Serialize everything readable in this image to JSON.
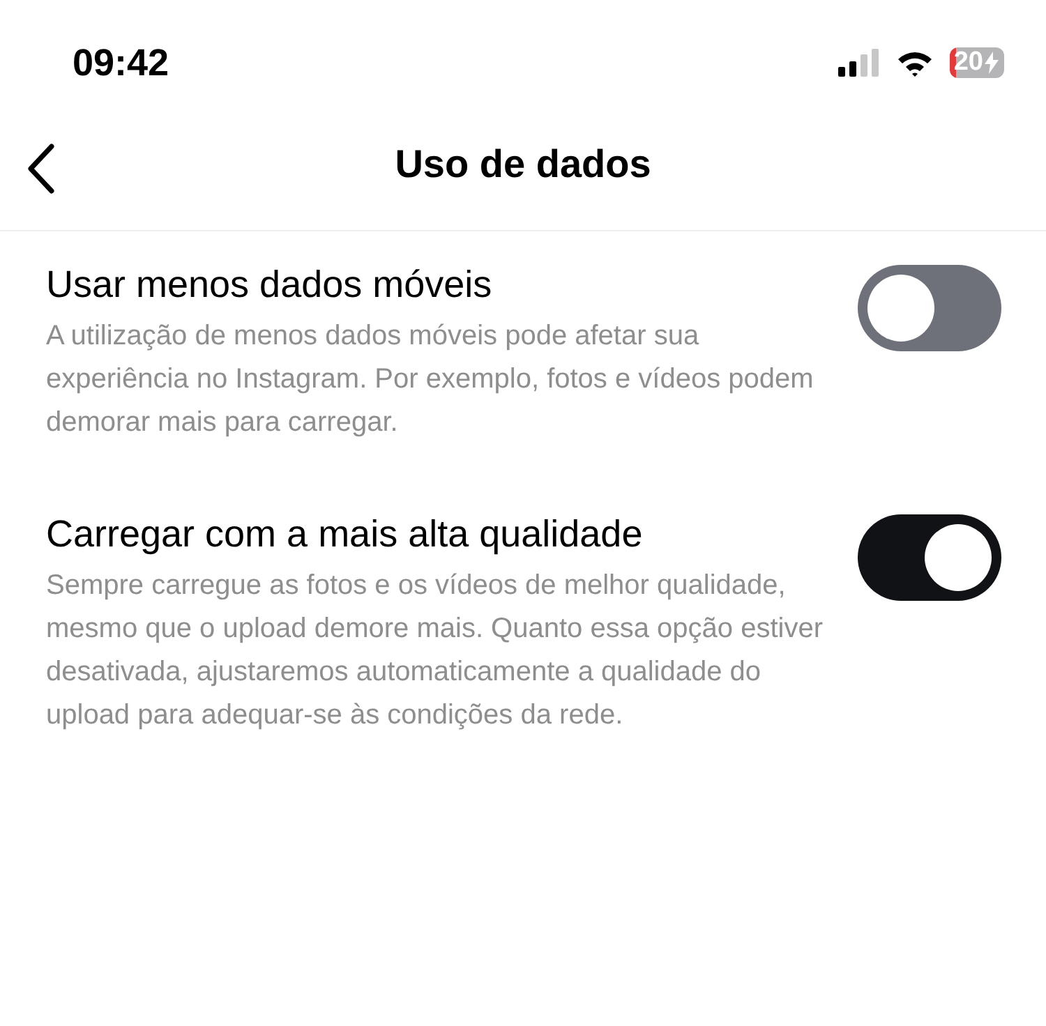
{
  "status_bar": {
    "time": "09:42",
    "battery": "20"
  },
  "nav": {
    "title": "Uso de dados"
  },
  "settings": [
    {
      "title": "Usar menos dados móveis",
      "description": "A utilização de menos dados móveis pode afetar sua experiência no Instagram. Por exemplo, fotos e vídeos podem demorar mais para carregar.",
      "on": false
    },
    {
      "title": "Carregar com a mais alta qualidade",
      "description": "Sempre carregue as fotos e os vídeos de melhor qualidade, mesmo que o upload demore mais. Quanto essa opção estiver desativada, ajustaremos automaticamente a qualidade do upload para adequar-se às condições da rede.",
      "on": true
    }
  ]
}
